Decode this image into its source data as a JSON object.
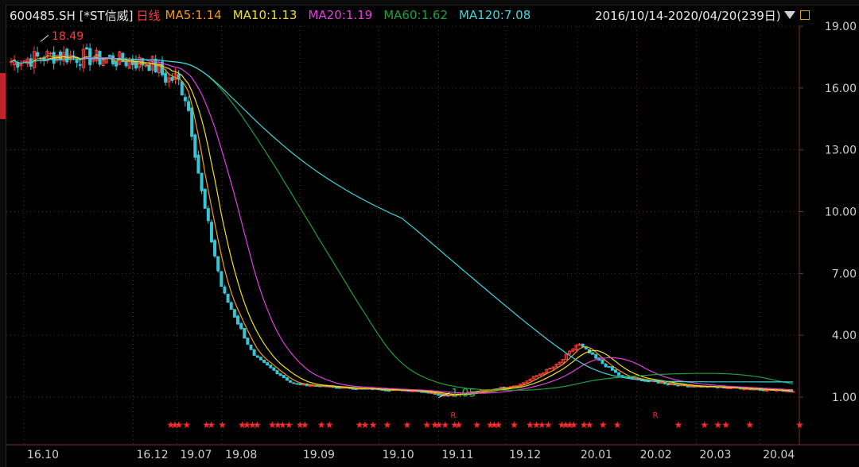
{
  "header": {
    "code": "600485.SH [*ST信威]",
    "period": "日线",
    "ma_items": [
      {
        "label": "MA5:1.14",
        "color": "#f39c12"
      },
      {
        "label": "MA10:1.13",
        "color": "#f0e020"
      },
      {
        "label": "MA20:1.19",
        "color": "#e040e0"
      },
      {
        "label": "MA60:1.62",
        "color": "#1fa03a"
      },
      {
        "label": "MA120:7.08",
        "color": "#3fd6e0"
      }
    ],
    "range": "2016/10/14-2020/04/20(239日)"
  },
  "colors": {
    "up": "#ff3b3b",
    "down": "#36c6d6",
    "flat": "#e8e8e8",
    "star": "#ff2a2a",
    "grid": "#5a3030",
    "axis": "#cfcfcf"
  },
  "chart_data": {
    "type": "candlestick",
    "ylim": [
      0,
      20
    ],
    "y_ticks": [
      "19.00",
      "16.00",
      "13.00",
      "10.00",
      "7.00",
      "4.00",
      "1.00"
    ],
    "x_tick_labels": [
      "16.10",
      "16.12",
      "19.07",
      "19.08",
      "19.09",
      "19.10",
      "19.11",
      "19.12",
      "20.01",
      "20.02",
      "20.03",
      "20.04"
    ],
    "annotations": {
      "high": "18.49",
      "low": "1.05"
    },
    "R_markers": [
      "R",
      "R"
    ],
    "signal_glyph": "★"
  }
}
